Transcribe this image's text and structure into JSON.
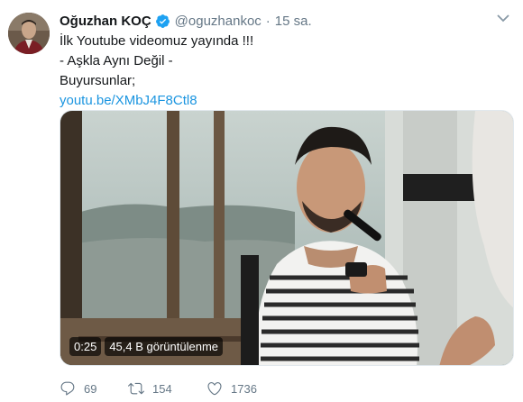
{
  "tweet": {
    "author_name": "Oğuzhan KOÇ",
    "handle": "@oguzhankoc",
    "separator": "·",
    "time": "15 sa.",
    "verified": true,
    "lines": [
      "İlk Youtube videomuz yayında !!!",
      "- Aşkla Aynı Değil -",
      "Buyursunlar;"
    ],
    "link_text": "youtu.be/XMbJ4F8Ctl8",
    "video": {
      "duration": "0:25",
      "views": "45,4 B görüntülenme"
    },
    "actions": {
      "replies": "69",
      "retweets": "154",
      "likes": "1736"
    }
  },
  "colors": {
    "text": "#14171a",
    "secondary": "#657786",
    "link": "#1b95e0",
    "verified": "#1da1f2"
  },
  "icons": [
    "verified-badge-icon",
    "caret-down-icon",
    "reply-icon",
    "retweet-icon",
    "like-icon"
  ]
}
